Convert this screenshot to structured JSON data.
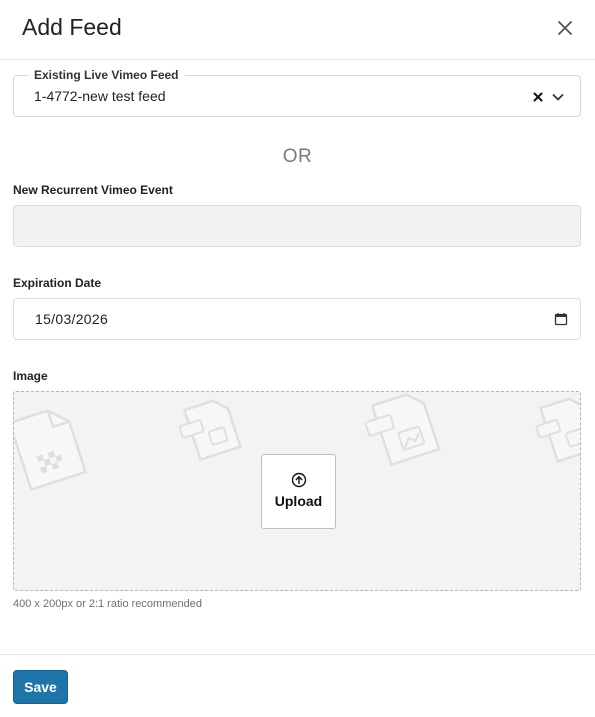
{
  "modal": {
    "title": "Add Feed",
    "close_icon": "close-icon"
  },
  "existing_feed": {
    "label": "Existing Live Vimeo Feed",
    "value": "1-4772-new test feed",
    "clear_icon": "clear-icon",
    "dropdown_icon": "chevron-down-icon"
  },
  "separator": {
    "text": "OR"
  },
  "recurrent_event": {
    "label": "New Recurrent Vimeo Event",
    "value": ""
  },
  "expiration": {
    "label": "Expiration Date",
    "value": "15/03/2026",
    "icon": "calendar-icon"
  },
  "image": {
    "label": "Image",
    "upload_label": "Upload",
    "upload_icon": "arrow-up-circle-icon",
    "hint": "400 x 200px or 2:1 ratio recommended"
  },
  "footer": {
    "save_label": "Save"
  },
  "colors": {
    "primary": "#1f74a8",
    "input_disabled_bg": "#f2f2f2",
    "dropzone_bg": "#f3f3f3"
  }
}
